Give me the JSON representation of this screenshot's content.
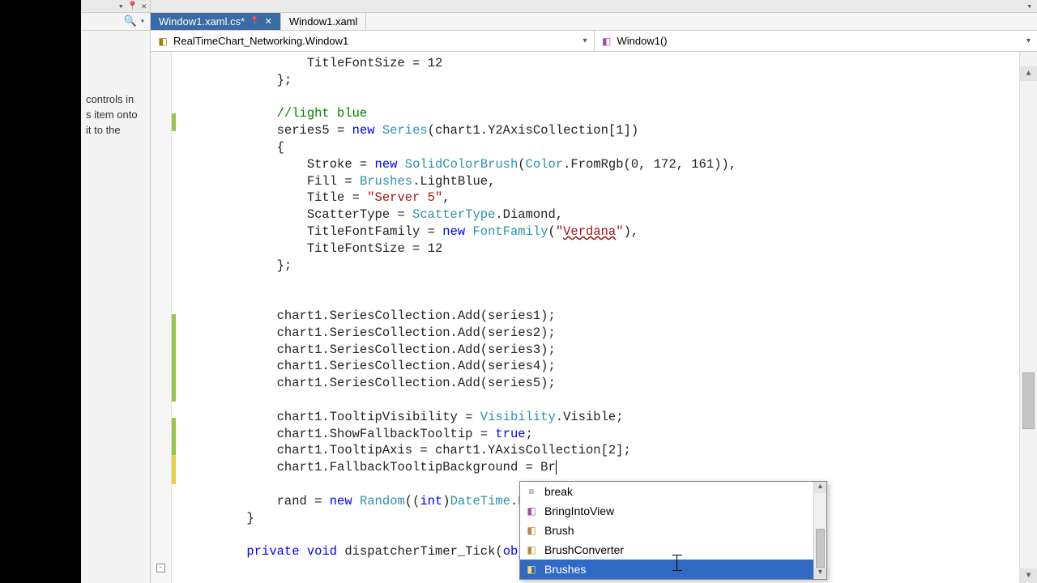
{
  "toolbox": {
    "hint": "controls in\ns item onto\nit to the"
  },
  "tabs": [
    {
      "label": "Window1.xaml.cs*",
      "active": true,
      "dirty": true
    },
    {
      "label": "Window1.xaml",
      "active": false,
      "dirty": false
    }
  ],
  "nav": {
    "class": "RealTimeChart_Networking.Window1",
    "member": "Window1()"
  },
  "code": {
    "l1": "                TitleFontSize = 12",
    "l2": "            };",
    "l3": "",
    "l4": "            //light blue",
    "l5a": "            series5 = ",
    "l5b": "new",
    "l5c": " ",
    "l5d": "Series",
    "l5e": "(chart1.Y2AxisCollection[1])",
    "l6": "            {",
    "l7a": "                Stroke = ",
    "l7b": "new",
    "l7c": " ",
    "l7d": "SolidColorBrush",
    "l7e": "(",
    "l7f": "Color",
    "l7g": ".FromRgb(0, 172, 161)),",
    "l8a": "                Fill = ",
    "l8b": "Brushes",
    "l8c": ".LightBlue,",
    "l9a": "                Title = ",
    "l9b": "\"Server 5\"",
    "l9c": ",",
    "l10a": "                ScatterType = ",
    "l10b": "ScatterType",
    "l10c": ".Diamond,",
    "l11a": "                TitleFontFamily = ",
    "l11b": "new",
    "l11c": " ",
    "l11d": "FontFamily",
    "l11e": "(",
    "l11f": "\"",
    "l11g": "Verdana",
    "l11h": "\"",
    "l11i": "),",
    "l12": "                TitleFontSize = 12",
    "l13": "            };",
    "l14": "",
    "l15": "",
    "l16": "            chart1.SeriesCollection.Add(series1);",
    "l17": "            chart1.SeriesCollection.Add(series2);",
    "l18": "            chart1.SeriesCollection.Add(series3);",
    "l19": "            chart1.SeriesCollection.Add(series4);",
    "l20": "            chart1.SeriesCollection.Add(series5);",
    "l21": "",
    "l22a": "            chart1.TooltipVisibility = ",
    "l22b": "Visibility",
    "l22c": ".Visible;",
    "l23a": "            chart1.ShowFallbackTooltip = ",
    "l23b": "true",
    "l23c": ";",
    "l24": "            chart1.TooltipAxis = chart1.YAxisCollection[2];",
    "l25a": "            chart1.FallbackTooltipBackground = Br",
    "l26": "",
    "l27a": "            rand = ",
    "l27b": "new",
    "l27c": " ",
    "l27d": "Random",
    "l27e": "((",
    "l27f": "int",
    "l27g": ")",
    "l27h": "DateTime",
    "l27i": ".Now",
    "l28": "        }",
    "l29": "",
    "l30a": "        ",
    "l30b": "private",
    "l30c": " ",
    "l30d": "void",
    "l30e": " dispatcherTimer_Tick(",
    "l30f": "objec"
  },
  "intellisense": {
    "items": [
      {
        "label": "break",
        "kind": "kw"
      },
      {
        "label": "BringIntoView",
        "kind": "mth"
      },
      {
        "label": "Brush",
        "kind": "cls"
      },
      {
        "label": "BrushConverter",
        "kind": "cls"
      },
      {
        "label": "Brushes",
        "kind": "cls",
        "selected": true
      }
    ]
  }
}
